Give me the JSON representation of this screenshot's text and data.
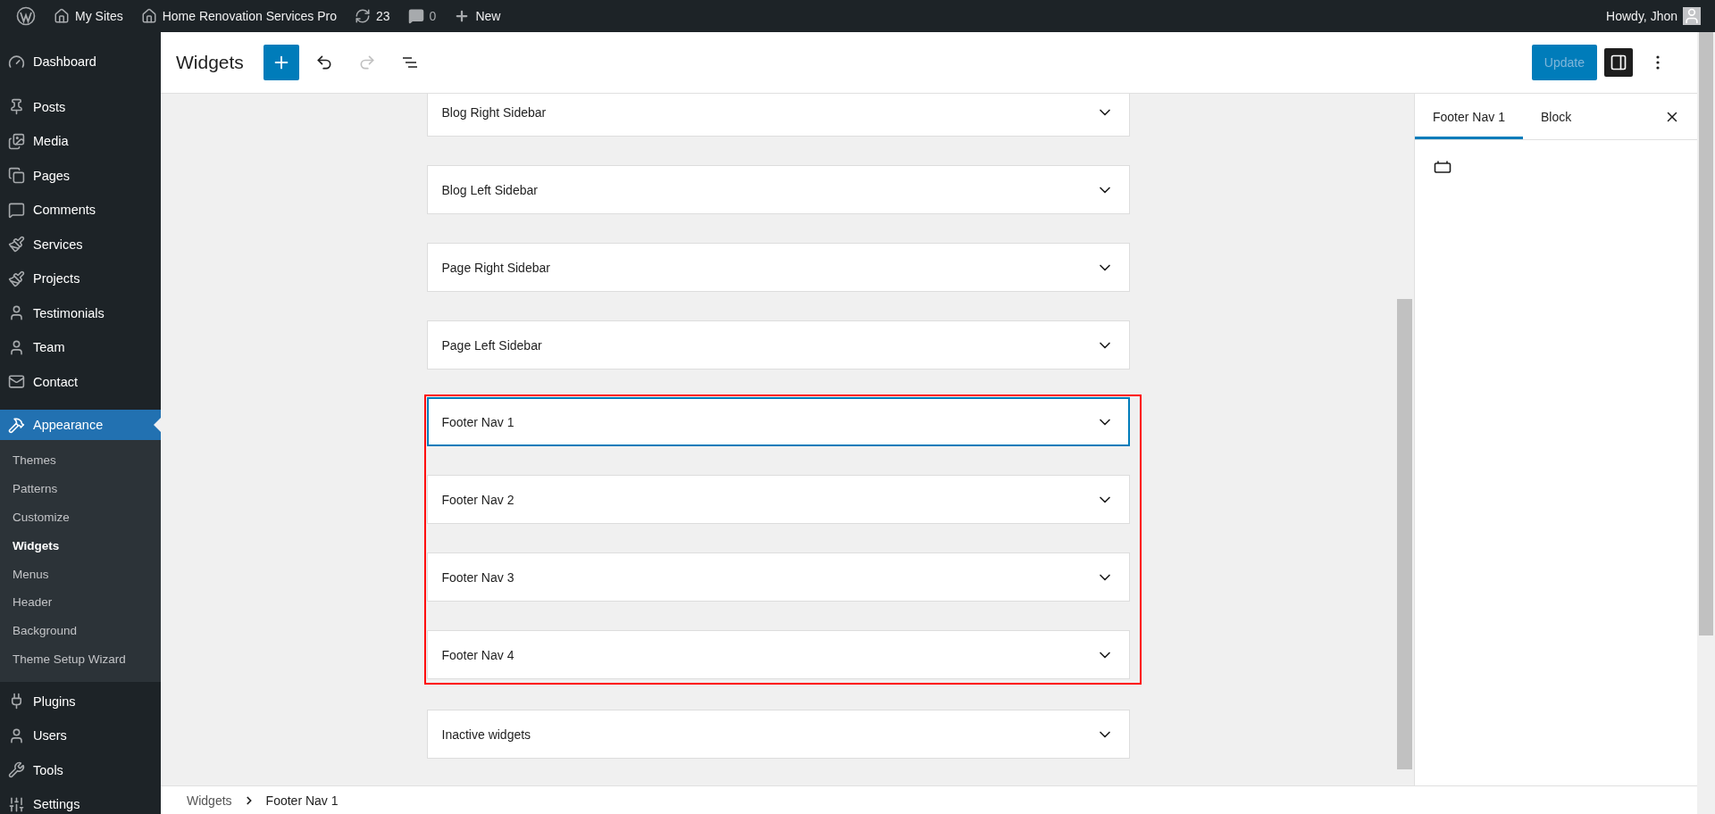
{
  "admin_bar": {
    "my_sites": "My Sites",
    "site_name": "Home Renovation Services Pro",
    "updates": "23",
    "comments": "0",
    "new": "New",
    "greeting": "Howdy, Jhon"
  },
  "sidebar": {
    "items": [
      {
        "label": "Dashboard",
        "selected": false
      },
      {
        "label": "Posts",
        "selected": false
      },
      {
        "label": "Media",
        "selected": false
      },
      {
        "label": "Pages",
        "selected": false
      },
      {
        "label": "Comments",
        "selected": false
      },
      {
        "label": "Services",
        "selected": false
      },
      {
        "label": "Projects",
        "selected": false
      },
      {
        "label": "Testimonials",
        "selected": false
      },
      {
        "label": "Team",
        "selected": false
      },
      {
        "label": "Contact",
        "selected": false
      },
      {
        "label": "Appearance",
        "selected": true,
        "children": [
          {
            "label": "Themes",
            "selected": false
          },
          {
            "label": "Patterns",
            "selected": false
          },
          {
            "label": "Customize",
            "selected": false
          },
          {
            "label": "Widgets",
            "selected": true
          },
          {
            "label": "Menus",
            "selected": false
          },
          {
            "label": "Header",
            "selected": false
          },
          {
            "label": "Background",
            "selected": false
          },
          {
            "label": "Theme Setup Wizard",
            "selected": false
          }
        ]
      },
      {
        "label": "Plugins",
        "selected": false
      },
      {
        "label": "Users",
        "selected": false
      },
      {
        "label": "Tools",
        "selected": false
      },
      {
        "label": "Settings",
        "selected": false
      }
    ]
  },
  "header": {
    "title": "Widgets",
    "update_button": {
      "label": "Update",
      "disabled": true
    }
  },
  "widget_areas": [
    {
      "kind": "area",
      "label": "Blog Right Sidebar",
      "selected": false
    },
    {
      "kind": "area",
      "label": "Blog Left Sidebar",
      "selected": false
    },
    {
      "kind": "area",
      "label": "Page Right Sidebar",
      "selected": false
    },
    {
      "kind": "area",
      "label": "Page Left Sidebar",
      "selected": false
    },
    {
      "kind": "highlight_group",
      "items": [
        {
          "label": "Footer Nav 1",
          "selected": true
        },
        {
          "label": "Footer Nav 2",
          "selected": false
        },
        {
          "label": "Footer Nav 3",
          "selected": false
        },
        {
          "label": "Footer Nav 4",
          "selected": false
        }
      ]
    },
    {
      "kind": "area",
      "label": "Inactive widgets",
      "selected": false
    }
  ],
  "inspector": {
    "tabs": [
      {
        "label": "Footer Nav 1",
        "selected": true
      },
      {
        "label": "Block",
        "selected": false
      }
    ]
  },
  "breadcrumb": [
    "Widgets",
    "Footer Nav 1"
  ]
}
